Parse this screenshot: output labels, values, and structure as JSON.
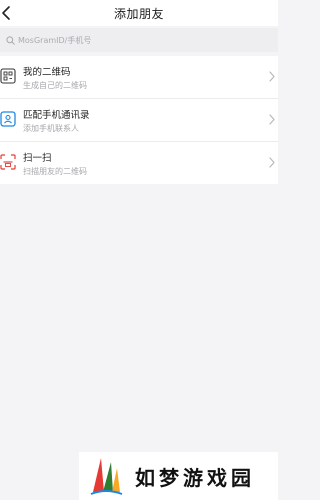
{
  "header": {
    "title": "添加朋友",
    "back_icon": "chevron-left-icon"
  },
  "search": {
    "placeholder": "MosGramID/手机号",
    "icon": "search-icon"
  },
  "options": [
    {
      "title": "我的二维码",
      "subtitle": "生成自己的二维码",
      "icon": "qr-code-icon"
    },
    {
      "title": "匹配手机通讯录",
      "subtitle": "添加手机联系人",
      "icon": "phone-contacts-icon"
    },
    {
      "title": "扫一扫",
      "subtitle": "扫描朋友的二维码",
      "icon": "scan-icon"
    }
  ],
  "watermark": {
    "text": "如梦游戏园",
    "logo_icon": "sail-logo-icon"
  },
  "colors": {
    "background": "#f4f4f6",
    "accent_blue": "#1e88e5",
    "accent_red": "#e53935",
    "subtitle_gray": "#a7a7ad"
  }
}
